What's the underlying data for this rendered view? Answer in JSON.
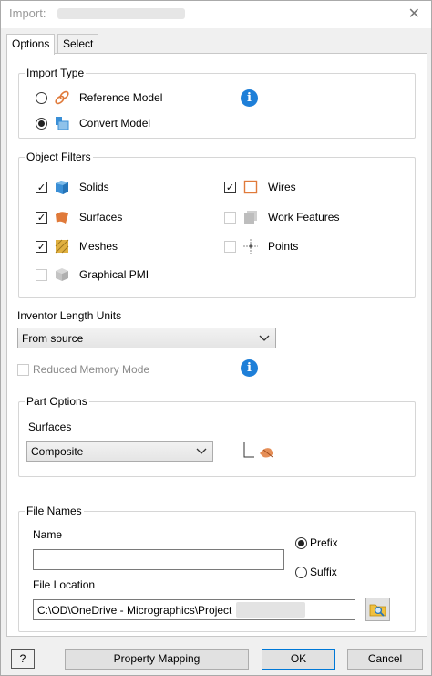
{
  "window": {
    "title": "Import:",
    "close_glyph": "✕"
  },
  "tabs": [
    {
      "label": "Options",
      "active": true
    },
    {
      "label": "Select",
      "active": false
    }
  ],
  "import_type": {
    "title": "Import Type",
    "options": [
      {
        "label": "Reference Model",
        "selected": false,
        "icon": "link-icon"
      },
      {
        "label": "Convert Model",
        "selected": true,
        "icon": "convert-model-icon"
      }
    ],
    "info_glyph": "i"
  },
  "object_filters": {
    "title": "Object Filters",
    "solids": {
      "label": "Solids",
      "checked": true
    },
    "surfaces": {
      "label": "Surfaces",
      "checked": true
    },
    "meshes": {
      "label": "Meshes",
      "checked": true
    },
    "graphical_pmi": {
      "label": "Graphical PMI",
      "checked": false
    },
    "wires": {
      "label": "Wires",
      "checked": true
    },
    "work_features": {
      "label": "Work Features",
      "checked": false
    },
    "points": {
      "label": "Points",
      "checked": false
    }
  },
  "length_units": {
    "label": "Inventor Length Units",
    "value": "From source"
  },
  "reduced_memory": {
    "label": "Reduced Memory Mode",
    "checked": false,
    "enabled": false
  },
  "part_options": {
    "title": "Part Options",
    "surfaces_label": "Surfaces",
    "surfaces_value": "Composite"
  },
  "file_names": {
    "title": "File Names",
    "name_label": "Name",
    "name_value": "",
    "prefix_label": "Prefix",
    "prefix_selected": true,
    "suffix_label": "Suffix",
    "suffix_selected": false,
    "location_label": "File Location",
    "location_value": "C:\\OD\\OneDrive - Micrographics\\Project"
  },
  "footer": {
    "help_glyph": "?",
    "property_mapping_label": "Property Mapping",
    "ok_label": "OK",
    "cancel_label": "Cancel"
  },
  "colors": {
    "info_blue": "#1e7fd8",
    "solid_blue": "#3a8fd6",
    "surface_orange": "#e07a3a",
    "mesh_yellow": "#e0b040"
  }
}
